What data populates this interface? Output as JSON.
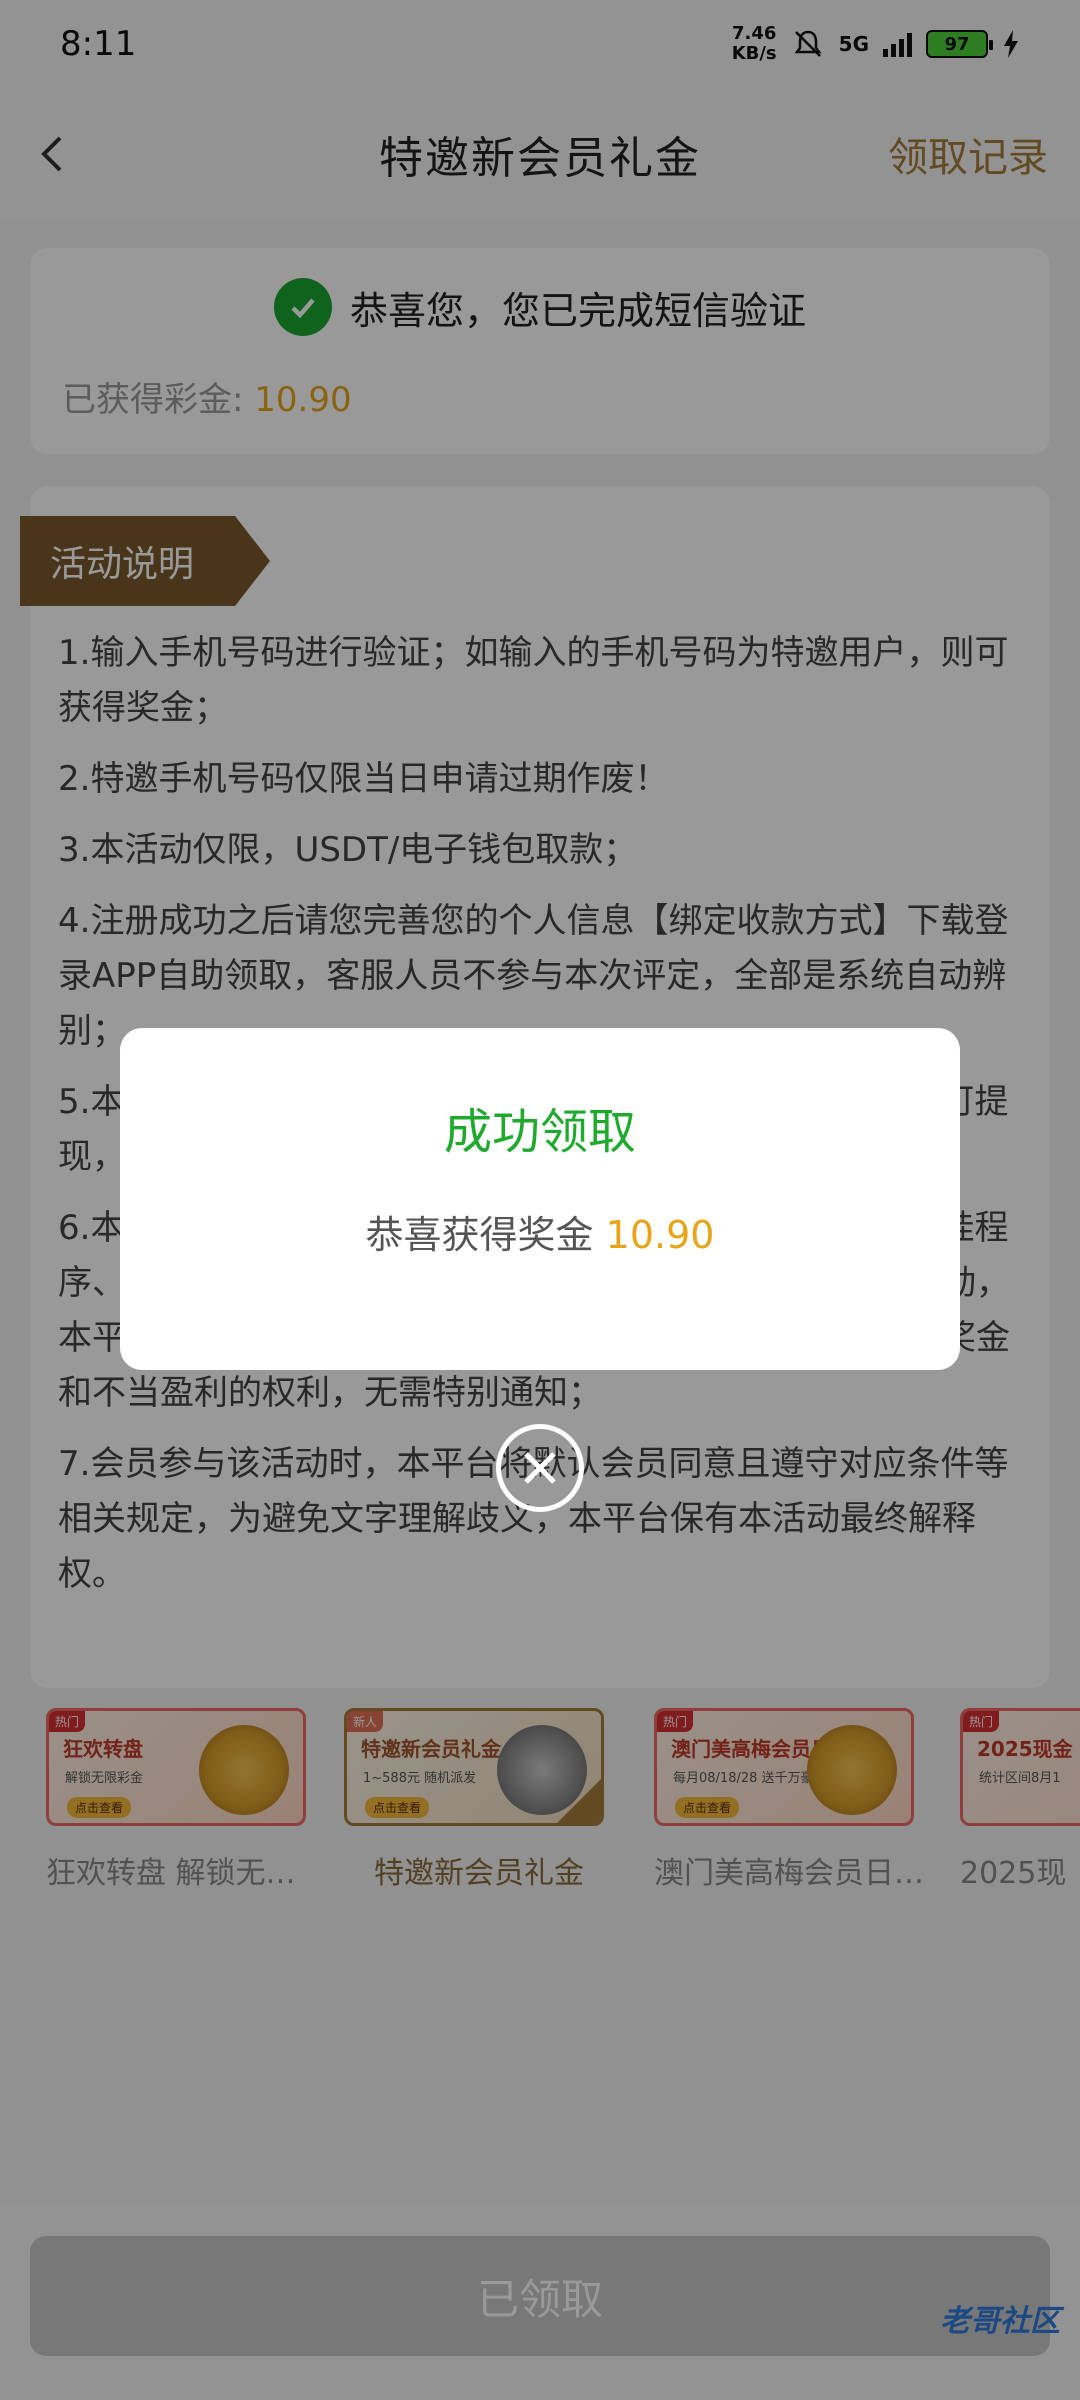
{
  "status_bar": {
    "time": "8:11",
    "net_speed_value": "7.46",
    "net_speed_unit": "KB/s",
    "network": "5G",
    "battery": "97"
  },
  "header": {
    "title": "特邀新会员礼金",
    "records_link": "领取记录"
  },
  "verify_card": {
    "message": "恭喜您，您已完成短信验证",
    "earned_label": "已获得彩金: ",
    "earned_amount": "10.90"
  },
  "activity": {
    "tag": "活动说明",
    "rules": [
      "1.输入手机号码进行验证；如输入的手机号码为特邀用户，则可获得奖金；",
      "2.特邀手机号码仅限当日申请过期作废！",
      "3.本活动仅限，USDT/电子钱包取款；",
      "4.注册成功之后请您完善您的个人信息【绑定收款方式】下载登录APP自助领取，客服人员不参与本次评定，全部是系统自动辨别；",
      "5.本次活动彩金只需一倍流水即可提现，未满足流水要求不可提现，",
      "6.本平台一切优惠活动仅针对正常玩家，如发现会员利用外挂程序、套利行为、多重账户或其他任何不正当技术手段参与活动，本平台有权取消会员参与资格、暂停会员使用网站、及没收奖金和不当盈利的权利，无需特别通知；",
      "7.会员参与该活动时，本平台将默认会员同意且遵守对应条件等相关规定，为避免文字理解歧义，本平台保有本活动最终解释权。"
    ]
  },
  "promos": [
    {
      "title": "狂欢转盘",
      "subtitle": "解锁无限彩金",
      "button": "点击查看",
      "badge": "热门",
      "label": "狂欢转盘 解锁无限..."
    },
    {
      "title": "特邀新会员礼金",
      "subtitle": "1~588元 随机派发",
      "button": "点击查看",
      "badge": "新人",
      "label": "特邀新会员礼金"
    },
    {
      "title": "澳门美高梅会员日",
      "subtitle": "每月08/18/28 送千万豪礼",
      "button": "点击查看",
      "badge": "热门",
      "label": "澳门美高梅会员日 ..."
    },
    {
      "title": "2025现金",
      "subtitle": "统计区间8月1",
      "button": "点击查看",
      "badge": "热门",
      "label": "2025现"
    }
  ],
  "bottom": {
    "claimed_button": "已领取",
    "watermark": "老哥社区"
  },
  "modal": {
    "title": "成功领取",
    "message": "恭喜获得奖金 ",
    "amount": "10.90"
  },
  "colors": {
    "accent": "#a67c3a",
    "success": "#1faa2e",
    "amount": "#e8a317",
    "tag_bg": "#7a5a2c"
  }
}
